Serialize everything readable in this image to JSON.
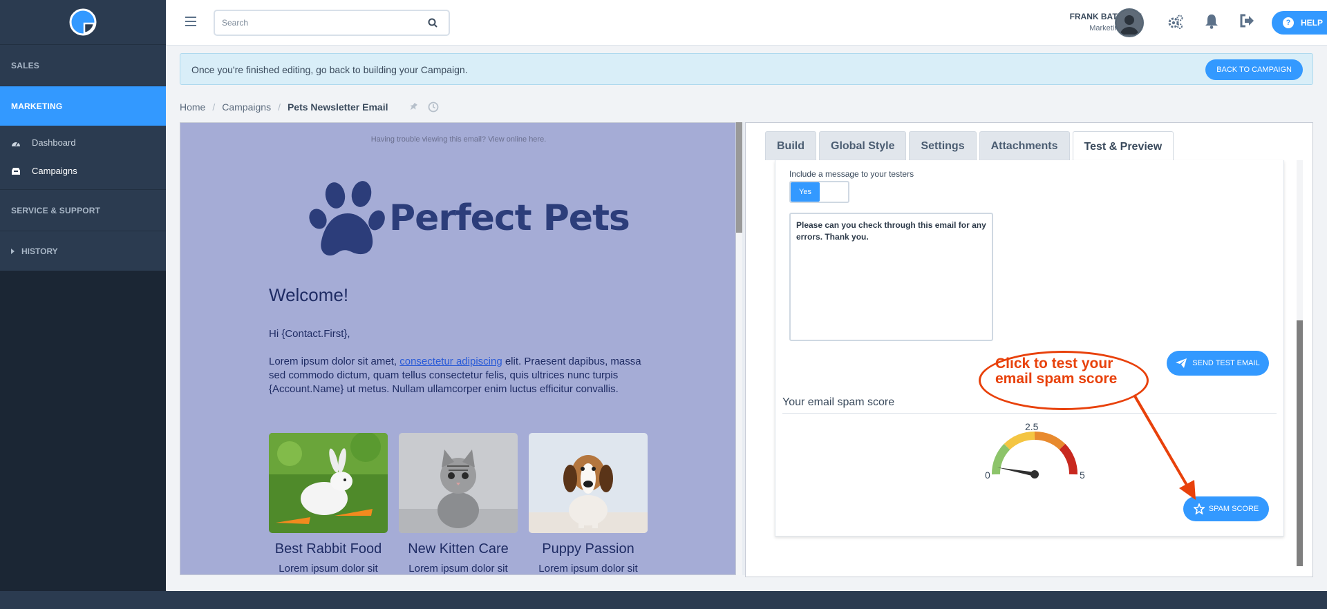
{
  "colors": {
    "accent": "#3399ff",
    "sidebar": "#1b2634",
    "sidebar_section": "#2b3b50",
    "preview_bg": "#a5acd6",
    "annotation": "#e8410b"
  },
  "sidebar": {
    "logo_icon": "company-logo",
    "sections": {
      "sales": "SALES",
      "marketing": "MARKETING",
      "service": "SERVICE & SUPPORT",
      "history": "HISTORY"
    },
    "items": [
      {
        "label": "Dashboard",
        "icon": "dashboard-icon"
      },
      {
        "label": "Campaigns",
        "icon": "inbox-icon"
      }
    ]
  },
  "header": {
    "search_placeholder": "Search",
    "user_name": "FRANK BATEMAN",
    "user_role": "Marketing Guru",
    "help_label": "HELP"
  },
  "banner": {
    "message": "Once you're finished editing, go back to building your Campaign.",
    "button_label": "BACK TO CAMPAIGN"
  },
  "breadcrumb": {
    "home": "Home",
    "campaigns": "Campaigns",
    "current": "Pets Newsletter Email"
  },
  "email": {
    "top_text": "Having trouble viewing this email? View online here.",
    "logo_text": "Perfect Pets",
    "heading": "Welcome!",
    "greeting": "Hi {Contact.First},",
    "body_prefix": "Lorem ipsum dolor sit amet, ",
    "body_link": "consectetur adipiscing",
    "body_suffix": " elit. Praesent dapibus, massa sed commodo dictum, quam tellus consectetur felis, quis ultrices nunc turpis {Account.Name} ut metus. Nullam ullamcorper enim luctus efficitur convallis.",
    "products": [
      {
        "name": "Best Rabbit Food",
        "desc": "Lorem ipsum dolor sit"
      },
      {
        "name": "New Kitten Care",
        "desc": "Lorem ipsum dolor sit"
      },
      {
        "name": "Puppy Passion",
        "desc": "Lorem ipsum dolor sit"
      }
    ]
  },
  "tabs": [
    "Build",
    "Global Style",
    "Settings",
    "Attachments",
    "Test & Preview"
  ],
  "test_preview": {
    "include_label": "Include a message to your testers",
    "toggle_value": "Yes",
    "message": "Please can you check through this email for any errors. Thank you.",
    "send_button": "SEND TEST EMAIL",
    "spam_title": "Your email spam score",
    "gauge": {
      "min": "0",
      "mid": "2.5",
      "max": "5",
      "value": 0
    },
    "spam_button": "SPAM SCORE"
  },
  "annotation": {
    "text": "Click to test your email spam score"
  }
}
